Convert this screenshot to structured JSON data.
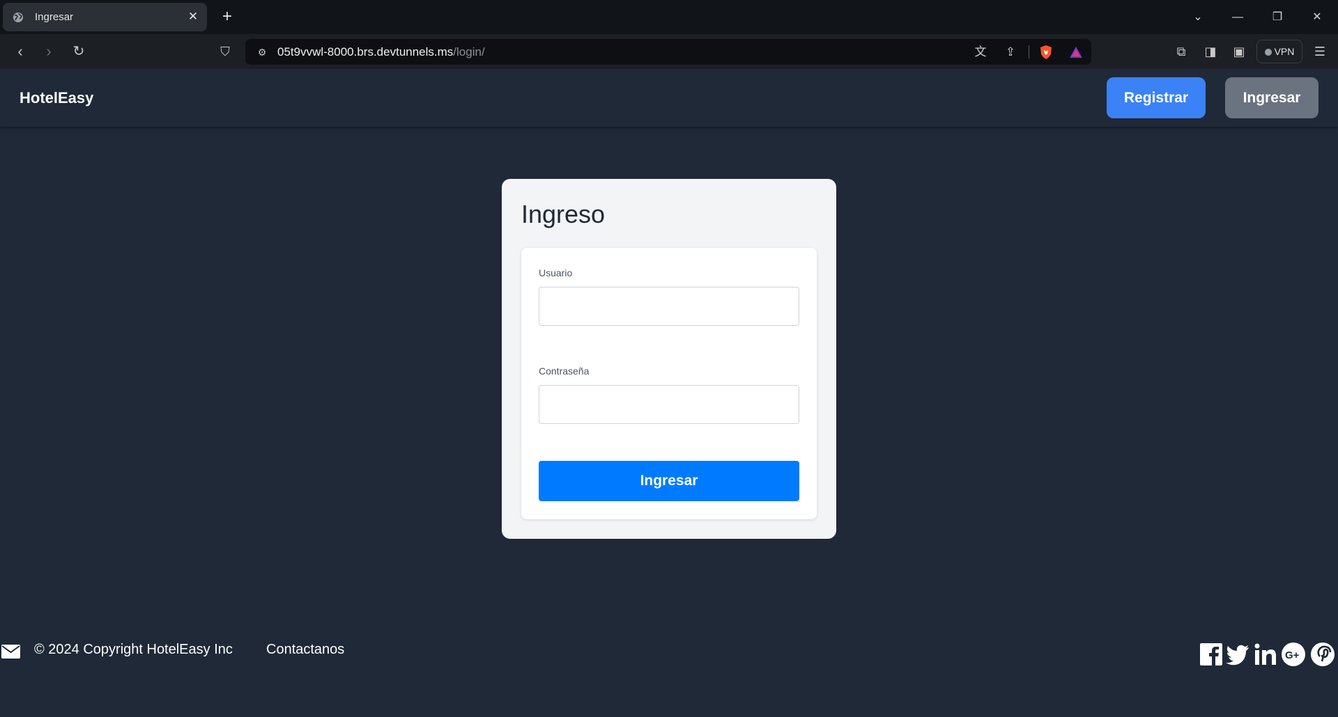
{
  "browser": {
    "tab_title": "Ingresar",
    "url_host": "05t9vvwl-8000.brs.devtunnels.ms",
    "url_path": "/login/",
    "vpn_label": "VPN"
  },
  "nav": {
    "brand": "HotelEasy",
    "register_label": "Registrar",
    "login_label": "Ingresar"
  },
  "login": {
    "title": "Ingreso",
    "username_label": "Usuario",
    "username_value": "",
    "password_label": "Contraseña",
    "password_value": "",
    "submit_label": "Ingresar"
  },
  "footer": {
    "copyright": "© 2024 Copyright HotelEasy Inc",
    "contact": "Contactanos",
    "social_icons": [
      "facebook-icon",
      "twitter-icon",
      "linkedin-icon",
      "google-plus-icon",
      "pinterest-icon"
    ]
  },
  "colors": {
    "page_bg": "#1f2937",
    "register_button": "#3b82f6",
    "login_button": "#6b7280",
    "submit_button": "#007bff"
  }
}
